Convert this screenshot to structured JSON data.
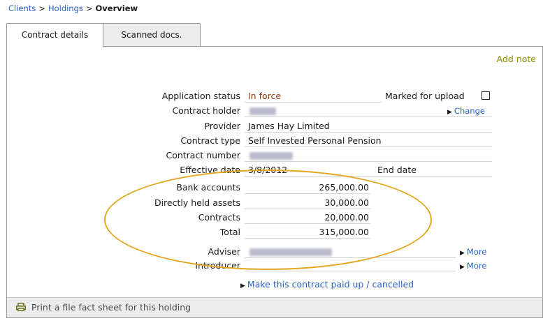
{
  "breadcrumb": {
    "clients": "Clients",
    "holdings": "Holdings",
    "current": "Overview",
    "separator": ">"
  },
  "tabs": [
    {
      "label": "Contract details"
    },
    {
      "label": "Scanned docs."
    }
  ],
  "panel": {
    "add_note": "Add note",
    "fields": {
      "application_status": {
        "label": "Application status",
        "value": "In force"
      },
      "marked_for_upload": {
        "label": "Marked for upload",
        "checked": false
      },
      "contract_holder": {
        "label": "Contract holder",
        "value": ""
      },
      "change_link": "Change",
      "provider": {
        "label": "Provider",
        "value": "James Hay Limited"
      },
      "contract_type": {
        "label": "Contract type",
        "value": "Self Invested Personal Pension"
      },
      "contract_number": {
        "label": "Contract number",
        "value": ""
      },
      "effective_date": {
        "label": "Effective date",
        "value": "3/8/2012"
      },
      "end_date": {
        "label": "End date",
        "value": ""
      }
    },
    "holdings": [
      {
        "label": "Bank accounts",
        "value": "265,000.00"
      },
      {
        "label": "Directly held assets",
        "value": "30,000.00"
      },
      {
        "label": "Contracts",
        "value": "20,000.00"
      },
      {
        "label": "Total",
        "value": "315,000.00"
      }
    ],
    "adviser": {
      "label": "Adviser",
      "value": "",
      "more_link": "More"
    },
    "introducer": {
      "label": "Introducer",
      "value": "",
      "more_link": "More"
    },
    "paid_up_link": "Make this contract paid up / cancelled"
  },
  "footer": {
    "print_label": "Print a file fact sheet for this holding",
    "icon": "printer-icon"
  },
  "colors": {
    "link": "#2a63c5",
    "highlight_oval": "#e5a61f",
    "add_note": "#8a8a00"
  }
}
